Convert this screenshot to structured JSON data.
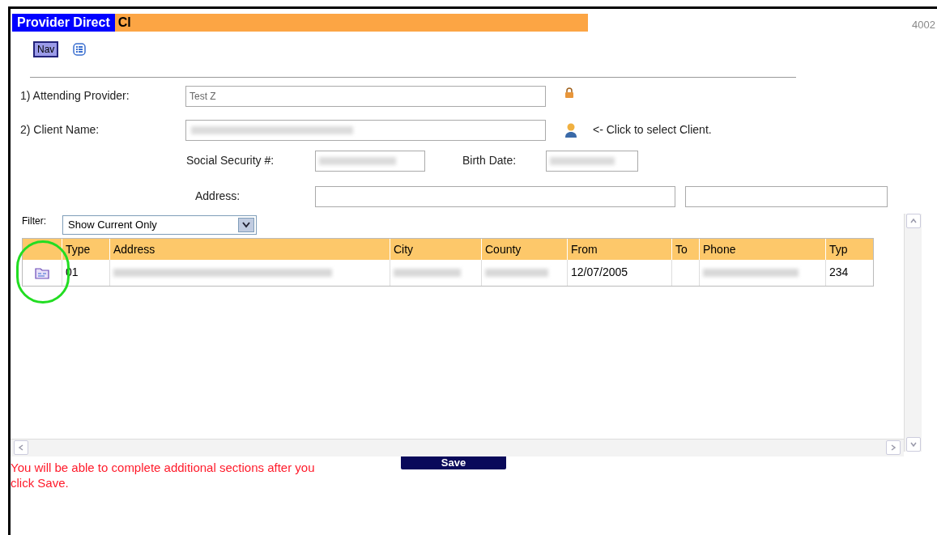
{
  "header": {
    "title": "Provider Direct",
    "subtitle": "Cl",
    "code": "4002"
  },
  "toolbar": {
    "nav_button": "Nav"
  },
  "form": {
    "attending_provider": {
      "label": "1) Attending Provider:",
      "value": "Test Z",
      "locked": true
    },
    "client_name": {
      "label": "2) Client Name:",
      "hint": "<- Click to select Client."
    },
    "ssn": {
      "label": "Social Security #:"
    },
    "birth_date": {
      "label": "Birth Date:"
    },
    "address": {
      "label": "Address:"
    }
  },
  "filter": {
    "label": "Filter:",
    "value": "Show Current Only"
  },
  "table": {
    "columns": [
      "Type",
      "Address",
      "City",
      "County",
      "From",
      "To",
      "Phone",
      "Typ"
    ],
    "rows": [
      {
        "cells": [
          {
            "text": "01"
          },
          {
            "redacted": true
          },
          {
            "redacted": true
          },
          {
            "redacted": true
          },
          {
            "text": "12/07/2005"
          },
          {},
          {
            "redacted": true
          },
          {
            "text": "234"
          }
        ]
      }
    ]
  },
  "save_button": "Save",
  "notice": "You will be able to complete additional sections after you click Save."
}
